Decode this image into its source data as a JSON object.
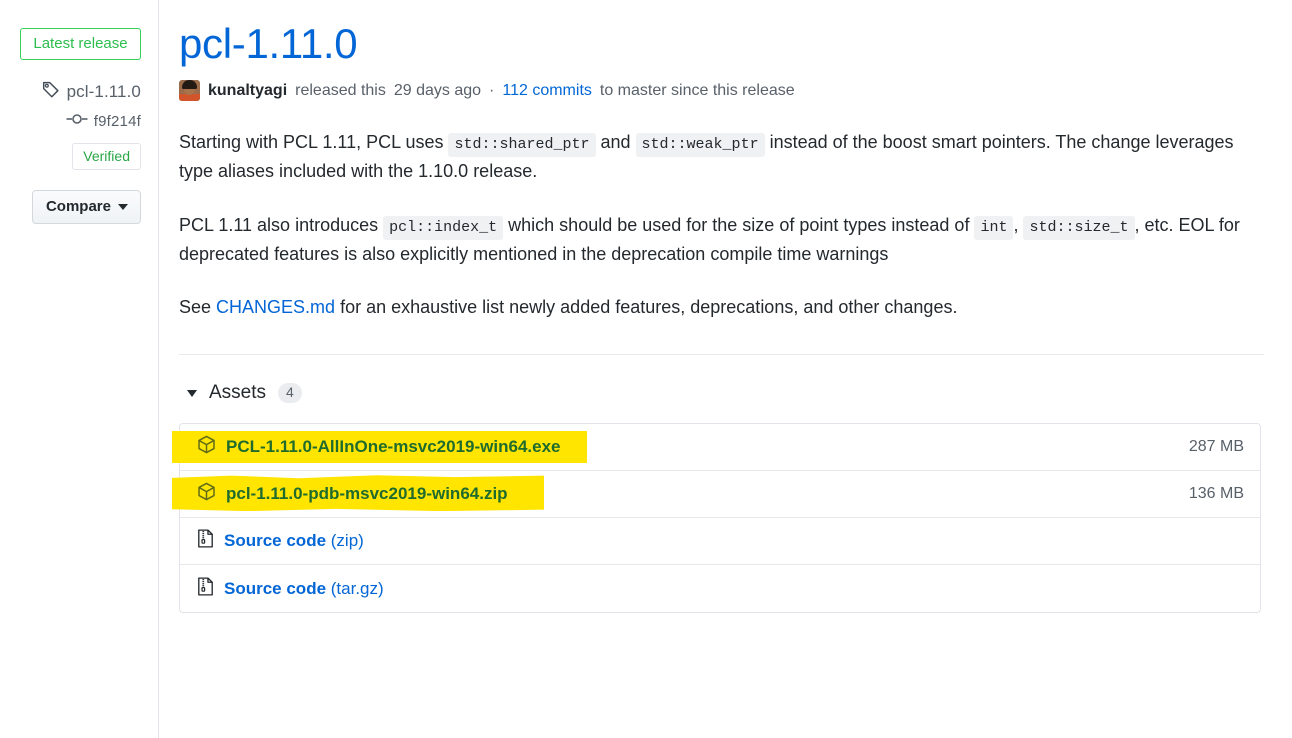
{
  "sidebar": {
    "latest_release_label": "Latest release",
    "tag_icon": "tag-icon",
    "tag_name": "pcl-1.11.0",
    "commit_icon": "commit-icon",
    "commit_sha": "f9f214f",
    "verified_label": "Verified",
    "compare_label": "Compare",
    "compare_caret_icon": "chevron-down-icon"
  },
  "release": {
    "title": "pcl-1.11.0",
    "author": "kunaltyagi",
    "released_text": "released this",
    "relative_date": "29 days ago",
    "separator": "·",
    "commits_link": "112 commits",
    "commits_suffix": "to master since this release"
  },
  "body": {
    "p1": {
      "t1": "Starting with PCL 1.11, PCL uses ",
      "code1": "std::shared_ptr",
      "t2": " and ",
      "code2": "std::weak_ptr",
      "t3": " instead of the boost smart pointers. The change leverages type aliases included with the 1.10.0 release."
    },
    "p2": {
      "t1": "PCL 1.11 also introduces ",
      "code1": "pcl::index_t",
      "t2": " which should be used for the size of point types instead of ",
      "code2": "int",
      "t3": ", ",
      "code3": "std::size_t",
      "t4": ", etc. EOL for deprecated features is also explicitly mentioned in the deprecation compile time warnings"
    },
    "p3": {
      "t1": "See ",
      "link": "CHANGES.md",
      "t2": " for an exhaustive list newly added features, deprecations, and other changes."
    }
  },
  "assets": {
    "caret_icon": "chevron-down-icon",
    "label": "Assets",
    "count": "4",
    "rows": [
      {
        "icon": "package-icon",
        "name": "PCL-1.11.0-AllInOne-msvc2019-win64.exe",
        "size": "287 MB",
        "highlighted": true
      },
      {
        "icon": "package-icon",
        "name": "pcl-1.11.0-pdb-msvc2019-win64.zip",
        "size": "136 MB",
        "highlighted": true
      },
      {
        "icon": "file-zip-icon",
        "name": "Source code",
        "ext": " (zip)",
        "size": "",
        "highlighted": false
      },
      {
        "icon": "file-zip-icon",
        "name": "Source code",
        "ext": " (tar.gz)",
        "size": "",
        "highlighted": false
      }
    ]
  },
  "colors": {
    "link_blue": "#0366d6",
    "green": "#2cbe4e",
    "highlight_yellow": "#ffe500",
    "highlighted_text_green": "#1f6b2e",
    "muted": "#586069"
  }
}
